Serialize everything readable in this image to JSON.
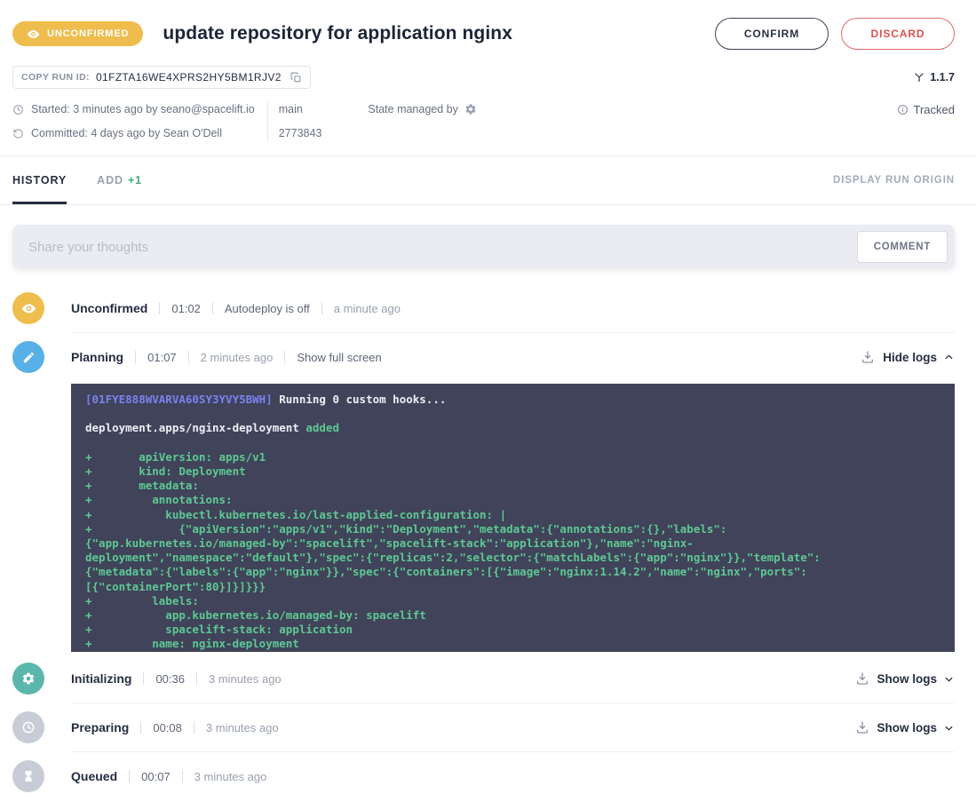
{
  "header": {
    "status_badge": "UNCONFIRMED",
    "title": "update repository for application nginx",
    "confirm_button": "CONFIRM",
    "discard_button": "DISCARD"
  },
  "run": {
    "copy_id_label": "COPY RUN ID:",
    "id": "01FZTA16WE4XPRS2HY5BM1RJV2",
    "version": "1.1.7",
    "tracked": "Tracked",
    "started": "Started: 3 minutes ago by seano@spacelift.io",
    "committed": "Committed: 4 days ago by Sean O'Dell",
    "branch": "main",
    "commit": "2773843",
    "state_managed_by": "State managed by"
  },
  "tabs": {
    "history": "HISTORY",
    "add": "ADD",
    "add_count": "+1",
    "display_run_origin": "DISPLAY RUN ORIGIN"
  },
  "comment": {
    "placeholder": "Share your thoughts",
    "button": "COMMENT"
  },
  "timeline": [
    {
      "state": "Unconfirmed",
      "duration": "01:02",
      "note": "Autodeploy is off",
      "ago": "a minute ago",
      "icon": "eye-icon"
    },
    {
      "state": "Planning",
      "duration": "01:07",
      "ago": "2 minutes ago",
      "link": "Show full screen",
      "logs_toggle": "Hide logs",
      "icon": "pencil-icon"
    },
    {
      "state": "Initializing",
      "duration": "00:36",
      "ago": "3 minutes ago",
      "logs_toggle": "Show logs",
      "icon": "gear-icon"
    },
    {
      "state": "Preparing",
      "duration": "00:08",
      "ago": "3 minutes ago",
      "logs_toggle": "Show logs",
      "icon": "clock-icon"
    },
    {
      "state": "Queued",
      "duration": "00:07",
      "ago": "3 minutes ago",
      "icon": "hourglass-icon"
    }
  ],
  "icons": {
    "badge": "eye-icon",
    "run_id": "copy-icon",
    "version": "version-tag-icon",
    "tracked": "info-icon",
    "started": "clock-icon",
    "committed": "history-icon",
    "state_provider": "gear-icon",
    "logs_download": "download-icon",
    "collapse": "chevron-up-icon",
    "expand": "chevron-down-icon"
  },
  "colors": {
    "badge_bg": "#eebd4d",
    "confirm_border": "#3c4357",
    "discard_red": "#dd5050",
    "add_count_green": "#3fae76",
    "planning_blue": "#58b0e8",
    "initializing_teal": "#5bb7ac",
    "pending_grey": "#c8ccd6",
    "log_bg": "#404359",
    "log_green": "#5ec894",
    "log_purple": "#7b82ee"
  },
  "log": {
    "lines": [
      [
        {
          "t": "[01FYE888WVARVA60SY3YVY5BWH]",
          "c": "purple"
        },
        {
          "t": " Running 0 custom hooks...",
          "c": "white"
        }
      ],
      [],
      [
        {
          "t": "deployment.apps/nginx-deployment",
          "c": "white"
        },
        {
          "t": " added",
          "c": "green"
        }
      ],
      [],
      [
        {
          "t": "+       apiVersion: apps/v1",
          "c": "green"
        }
      ],
      [
        {
          "t": "+       kind: Deployment",
          "c": "green"
        }
      ],
      [
        {
          "t": "+       metadata:",
          "c": "green"
        }
      ],
      [
        {
          "t": "+         annotations:",
          "c": "green"
        }
      ],
      [
        {
          "t": "+           kubectl.kubernetes.io/last-applied-configuration: |",
          "c": "green"
        }
      ],
      [
        {
          "t": "+             {\"apiVersion\":\"apps/v1\",\"kind\":\"Deployment\",\"metadata\":{\"annotations\":{},\"labels\":",
          "c": "green"
        }
      ],
      [
        {
          "t": "{\"app.kubernetes.io/managed-by\":\"spacelift\",\"spacelift-stack\":\"application\"},\"name\":\"nginx-",
          "c": "green"
        }
      ],
      [
        {
          "t": "deployment\",\"namespace\":\"default\"},\"spec\":{\"replicas\":2,\"selector\":{\"matchLabels\":{\"app\":\"nginx\"}},\"template\":",
          "c": "green"
        }
      ],
      [
        {
          "t": "{\"metadata\":{\"labels\":{\"app\":\"nginx\"}},\"spec\":{\"containers\":[{\"image\":\"nginx:1.14.2\",\"name\":\"nginx\",\"ports\":",
          "c": "green"
        }
      ],
      [
        {
          "t": "[{\"containerPort\":80}]}]}}}",
          "c": "green"
        }
      ],
      [
        {
          "t": "+         labels:",
          "c": "green"
        }
      ],
      [
        {
          "t": "+           app.kubernetes.io/managed-by: spacelift",
          "c": "green"
        }
      ],
      [
        {
          "t": "+           spacelift-stack: application",
          "c": "green"
        }
      ],
      [
        {
          "t": "+         name: nginx-deployment",
          "c": "green"
        }
      ]
    ]
  }
}
